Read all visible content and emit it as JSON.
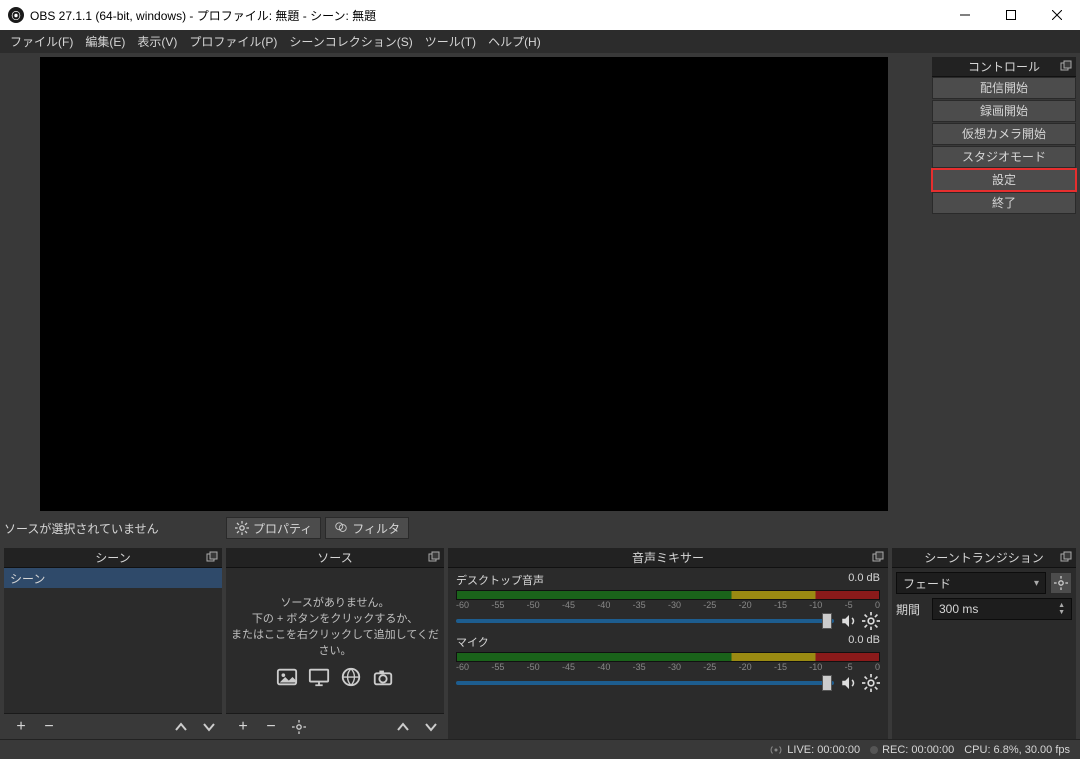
{
  "titlebar": {
    "title": "OBS 27.1.1 (64-bit, windows) - プロファイル: 無題 - シーン: 無題"
  },
  "menu": {
    "file": "ファイル(F)",
    "edit": "編集(E)",
    "view": "表示(V)",
    "profile": "プロファイル(P)",
    "scenecol": "シーンコレクション(S)",
    "tools": "ツール(T)",
    "help": "ヘルプ(H)"
  },
  "below_preview": {
    "no_source": "ソースが選択されていません",
    "properties": "プロパティ",
    "filters": "フィルタ"
  },
  "controls": {
    "header": "コントロール",
    "start_stream": "配信開始",
    "start_record": "録画開始",
    "virtual_cam": "仮想カメラ開始",
    "studio_mode": "スタジオモード",
    "settings": "設定",
    "exit": "終了"
  },
  "scenes": {
    "header": "シーン",
    "items": [
      {
        "name": "シーン"
      }
    ]
  },
  "sources": {
    "header": "ソース",
    "empty_line1": "ソースがありません。",
    "empty_line2": "下の + ボタンをクリックするか、",
    "empty_line3": "またはここを右クリックして追加してください。"
  },
  "mixer": {
    "header": "音声ミキサー",
    "channels": [
      {
        "name": "デスクトップ音声",
        "level": "0.0 dB"
      },
      {
        "name": "マイク",
        "level": "0.0 dB"
      }
    ],
    "ticks": [
      "-60",
      "-55",
      "-50",
      "-45",
      "-40",
      "-35",
      "-30",
      "-25",
      "-20",
      "-15",
      "-10",
      "-5",
      "0"
    ]
  },
  "transitions": {
    "header": "シーントランジション",
    "selected": "フェード",
    "duration_label": "期間",
    "duration_value": "300 ms"
  },
  "statusbar": {
    "live": "LIVE: 00:00:00",
    "rec": "REC: 00:00:00",
    "cpu": "CPU: 6.8%, 30.00 fps"
  }
}
